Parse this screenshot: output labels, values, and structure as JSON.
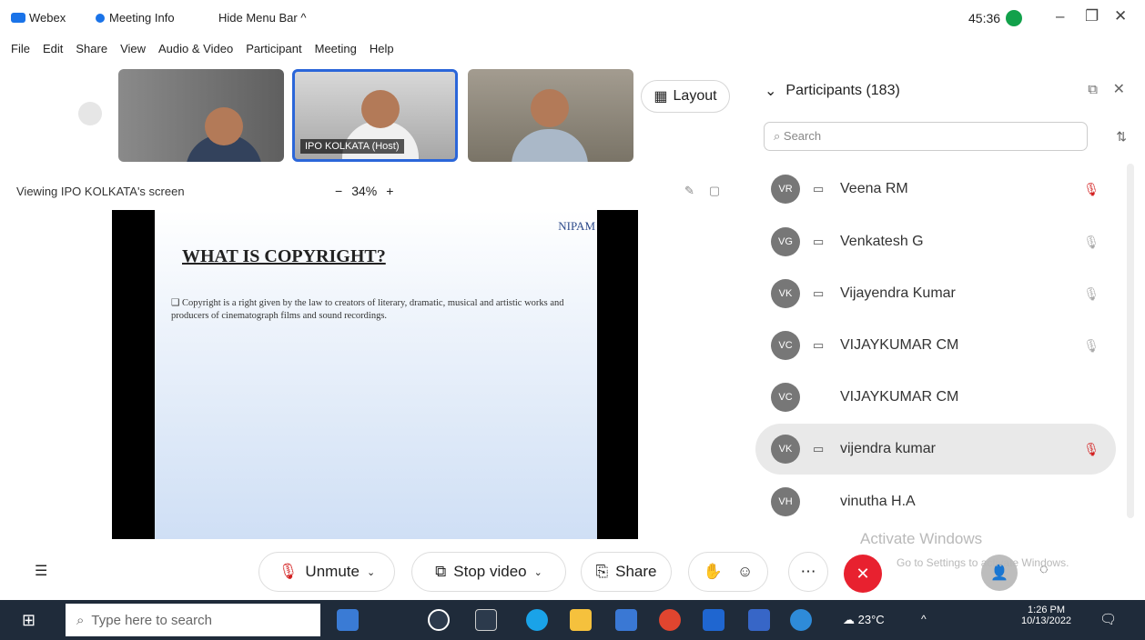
{
  "window": {
    "app_name": "Webex",
    "meeting_info": "Meeting Info",
    "hide_menu": "Hide Menu Bar",
    "timer": "45:36",
    "minimize": "–",
    "restore": "❐",
    "close": "✕"
  },
  "menu": [
    "File",
    "Edit",
    "Share",
    "View",
    "Audio & Video",
    "Participant",
    "Meeting",
    "Help"
  ],
  "videos": {
    "thumb2_name": "IPO KOLKATA (Host)"
  },
  "layout_label": "Layout",
  "viewing_text": "Viewing IPO KOLKATA's screen",
  "zoom": {
    "minus": "−",
    "value": "34%",
    "plus": "+"
  },
  "slide": {
    "logo": "NIPAM",
    "title": "WHAT IS COPYRIGHT?",
    "bullet": "Copyright is a right given by the law to creators of literary, dramatic, musical and artistic works and producers of cinematograph films and sound recordings."
  },
  "participants": {
    "title": "Participants (183)",
    "search_placeholder": "Search",
    "list": [
      {
        "initials": "VR",
        "name": "Veena RM",
        "device": "▭",
        "muted": true
      },
      {
        "initials": "VG",
        "name": "Venkatesh G",
        "device": "▭",
        "muted": true
      },
      {
        "initials": "VK",
        "name": "Vijayendra Kumar",
        "device": "▭",
        "muted": true
      },
      {
        "initials": "VC",
        "name": "VIJAYKUMAR CM",
        "device": "▭",
        "muted": true
      },
      {
        "initials": "VC",
        "name": "VIJAYKUMAR CM",
        "device": "",
        "muted": false
      },
      {
        "initials": "VK",
        "name": "vijendra kumar",
        "device": "▭",
        "muted": true
      },
      {
        "initials": "VH",
        "name": "vinutha H.A",
        "device": "",
        "muted": false
      }
    ]
  },
  "controls": {
    "unmute": "Unmute",
    "stop_video": "Stop video",
    "share": "Share"
  },
  "watermark": "Activate Windows",
  "watermark_sub": "Go to Settings to activate Windows.",
  "taskbar": {
    "search": "Type here to search",
    "temp": "23°C",
    "time": "1:26 PM",
    "date": "10/13/2022"
  },
  "colors": {
    "accent": "#2b66d9",
    "end_call": "#e8212f",
    "mute": "#d32020"
  }
}
